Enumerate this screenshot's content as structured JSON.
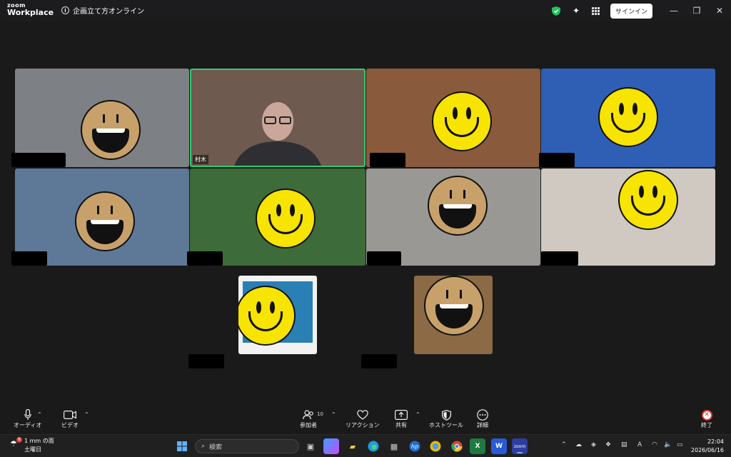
{
  "app": {
    "logo_line1": "zoom",
    "logo_line2": "Workplace",
    "meeting_title": "企画立て方オンライン",
    "signin_label": "サインイン"
  },
  "tiles": [
    {
      "id": "t1",
      "nameplate": "",
      "face": "tan",
      "bg": "#7d8085"
    },
    {
      "id": "t2",
      "nameplate": "村木",
      "face": "",
      "bg": "#6e5a4f",
      "active": true
    },
    {
      "id": "t3",
      "nameplate": "",
      "face": "yellow",
      "bg": "#8a5a3c"
    },
    {
      "id": "t4",
      "nameplate": "",
      "face": "yellow",
      "bg": "#2f5fb4"
    },
    {
      "id": "t5",
      "nameplate": "",
      "face": "tan",
      "bg": "#5e7898"
    },
    {
      "id": "t6",
      "nameplate": "",
      "face": "yellow",
      "bg": "#3d6b3a"
    },
    {
      "id": "t7",
      "nameplate": "",
      "face": "tan",
      "bg": "#9a9894"
    },
    {
      "id": "t8",
      "nameplate": "",
      "face": "yellow",
      "bg": "#cfc9c2"
    },
    {
      "id": "t9",
      "nameplate": "",
      "face": "yellow",
      "bg": "#f2f2f2"
    },
    {
      "id": "t10",
      "nameplate": "",
      "face": "tan",
      "bg": "#8c6a45"
    }
  ],
  "toolbar": {
    "audio": "オーディオ",
    "video": "ビデオ",
    "participants": "参加者",
    "participants_count": "10",
    "reactions": "リアクション",
    "share": "共有",
    "host_tools": "ホストツール",
    "more": "詳細",
    "end": "終了"
  },
  "taskbar": {
    "weather_text": "1 mm の雨",
    "weather_day": "土曜日",
    "weather_badge": "6",
    "search_placeholder": "検索",
    "ime": "A",
    "time": "22:04",
    "date": "2026/06/16"
  },
  "colors": {
    "active_border": "#2ecc71",
    "end_red": "#e53935"
  }
}
